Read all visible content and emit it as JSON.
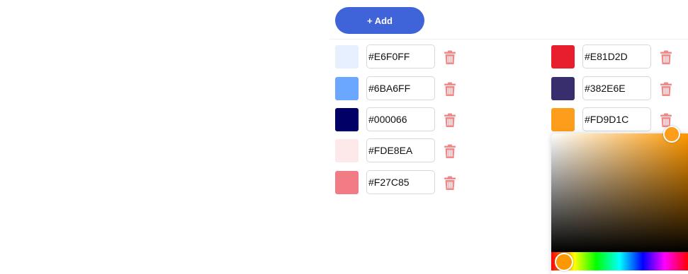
{
  "toolbar": {
    "add_label": "+ Add",
    "accent": "#3f63d8"
  },
  "palette": [
    {
      "hex": "#E6F0FF",
      "color": "#E6F0FF"
    },
    {
      "hex": "#6BA6FF",
      "color": "#6BA6FF"
    },
    {
      "hex": "#000066",
      "color": "#000066"
    },
    {
      "hex": "#FDE8EA",
      "color": "#FDE8EA"
    },
    {
      "hex": "#F27C85",
      "color": "#F27C85"
    },
    {
      "hex": "#E81D2D",
      "color": "#E81D2D"
    },
    {
      "hex": "#382E6E",
      "color": "#382E6E"
    },
    {
      "hex": "#FD9D1C",
      "color": "#FD9D1C"
    }
  ],
  "trash_color": "#f08a8a",
  "picker": {
    "hue_color": "#FF9800",
    "selected_color": "#FD9D1C",
    "hue_handle_color": "#FF9800"
  }
}
